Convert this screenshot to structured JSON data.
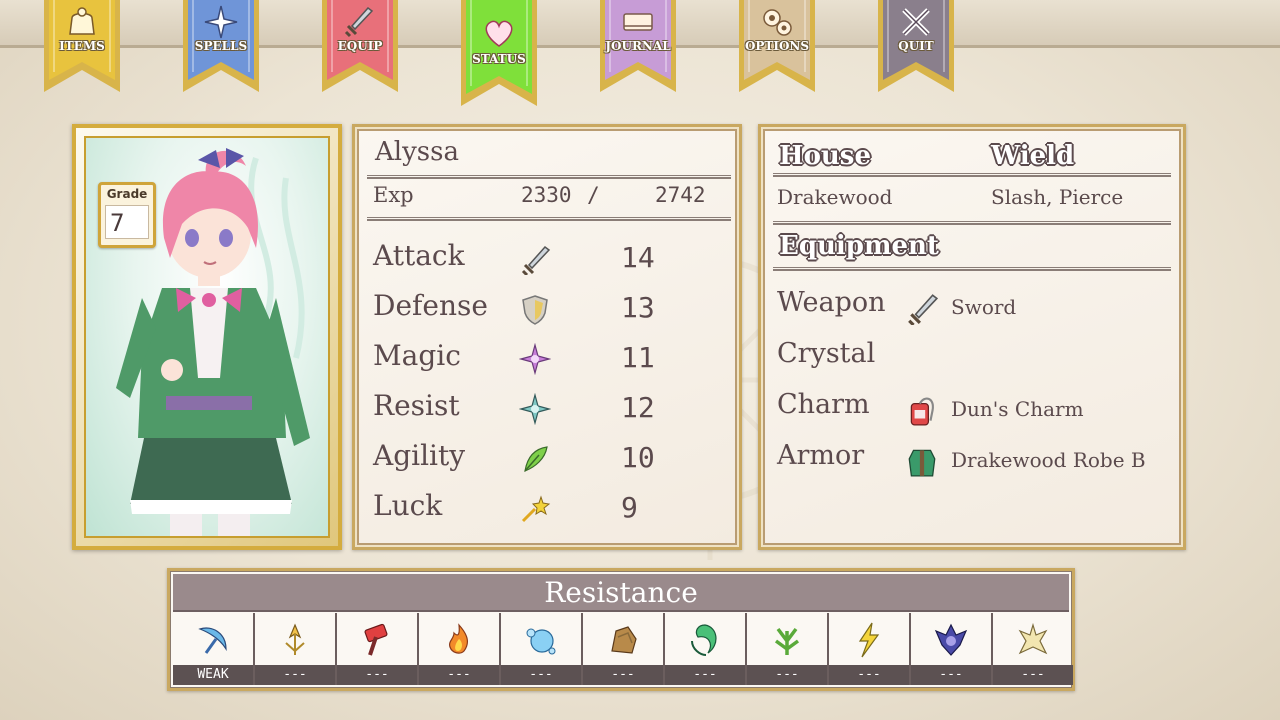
{
  "menu": {
    "tabs": [
      {
        "label": "ITEMS",
        "icon": "bag-icon",
        "color": "#e8c33e"
      },
      {
        "label": "SPELLS",
        "icon": "sparkle-icon",
        "color": "#6f95d8"
      },
      {
        "label": "EQUIP",
        "icon": "sword-icon",
        "color": "#e8707a"
      },
      {
        "label": "STATUS",
        "icon": "heart-icon",
        "color": "#7fe03a"
      },
      {
        "label": "JOURNAL",
        "icon": "book-icon",
        "color": "#c79cd6"
      },
      {
        "label": "OPTIONS",
        "icon": "gears-icon",
        "color": "#d9c29c"
      },
      {
        "label": "QUIT",
        "icon": "cross-icon",
        "color": "#8a7f8c"
      }
    ],
    "active_tab": "STATUS"
  },
  "character": {
    "grade_label": "Grade",
    "grade": "7",
    "name": "Alyssa",
    "exp_label": "Exp",
    "exp_current": "2330",
    "exp_separator": "/",
    "exp_max": "2742"
  },
  "stats": [
    {
      "name": "Attack",
      "icon": "sword-icon",
      "value": "14"
    },
    {
      "name": "Defense",
      "icon": "shield-icon",
      "value": "13"
    },
    {
      "name": "Magic",
      "icon": "magic-star-icon",
      "value": "11"
    },
    {
      "name": "Resist",
      "icon": "resist-star-icon",
      "value": "12"
    },
    {
      "name": "Agility",
      "icon": "feather-icon",
      "value": "10"
    },
    {
      "name": "Luck",
      "icon": "shooting-star-icon",
      "value": "9"
    }
  ],
  "info": {
    "house_header": "House",
    "wield_header": "Wield",
    "house": "Drakewood",
    "wield": "Slash, Pierce",
    "equipment_header": "Equipment"
  },
  "equipment": [
    {
      "slot": "Weapon",
      "icon": "sword-icon",
      "item": "Sword"
    },
    {
      "slot": "Crystal",
      "icon": "",
      "item": ""
    },
    {
      "slot": "Charm",
      "icon": "charm-pouch-icon",
      "item": "Dun's Charm"
    },
    {
      "slot": "Armor",
      "icon": "robe-icon",
      "item": "Drakewood Robe B"
    }
  ],
  "resistance": {
    "title": "Resistance",
    "elements": [
      {
        "icon": "slash-icon",
        "value": "WEAK"
      },
      {
        "icon": "pierce-icon",
        "value": "---"
      },
      {
        "icon": "blunt-icon",
        "value": "---"
      },
      {
        "icon": "fire-icon",
        "value": "---"
      },
      {
        "icon": "water-icon",
        "value": "---"
      },
      {
        "icon": "earth-icon",
        "value": "---"
      },
      {
        "icon": "wind-icon",
        "value": "---"
      },
      {
        "icon": "nature-icon",
        "value": "---"
      },
      {
        "icon": "lightning-icon",
        "value": "---"
      },
      {
        "icon": "dark-icon",
        "value": "---"
      },
      {
        "icon": "light-icon",
        "value": "---"
      }
    ]
  }
}
